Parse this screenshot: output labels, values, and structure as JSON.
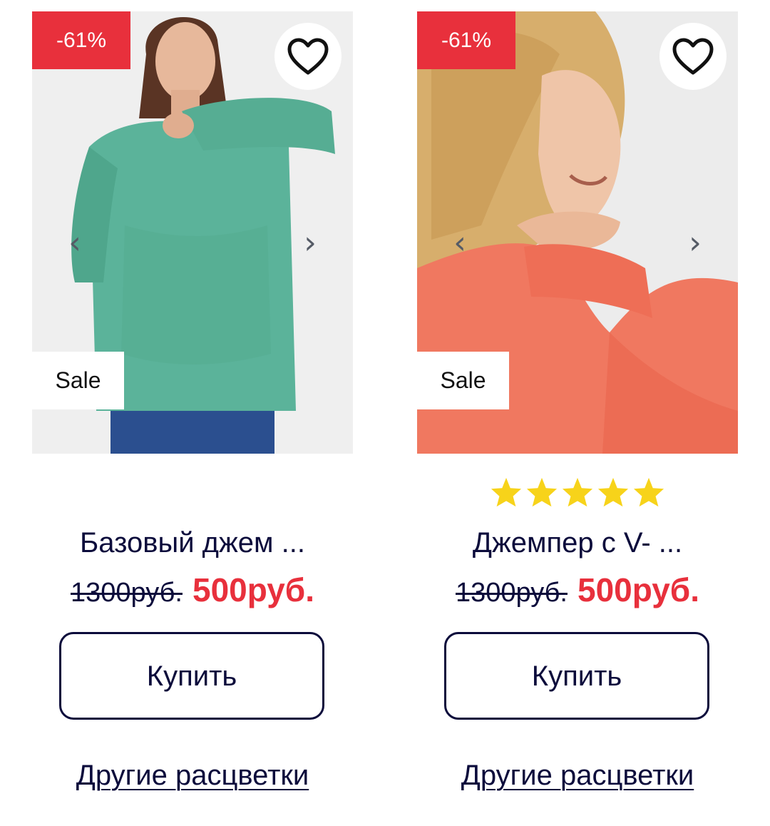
{
  "products": [
    {
      "discount_badge": "-61%",
      "sale_tag": "Sale",
      "prev_arrow": "‹",
      "next_arrow": "›",
      "rating_stars": 0,
      "title": "Базовый джем ...",
      "old_price": "1300руб.",
      "new_price": "500руб.",
      "buy_label": "Купить",
      "colors_link": "Другие расцветки",
      "sweater_color": "#5bb39a",
      "icons": [
        "heart-icon",
        "chevron-left-icon",
        "chevron-right-icon"
      ]
    },
    {
      "discount_badge": "-61%",
      "sale_tag": "Sale",
      "prev_arrow": "‹",
      "next_arrow": "›",
      "rating_stars": 5,
      "title": "Джемпер с V- ...",
      "old_price": "1300руб.",
      "new_price": "500руб.",
      "buy_label": "Купить",
      "colors_link": "Другие расцветки",
      "sweater_color": "#f07860",
      "icons": [
        "heart-icon",
        "chevron-left-icon",
        "chevron-right-icon",
        "star-icon"
      ]
    }
  ],
  "colors": {
    "accent_red": "#e8303c",
    "text_navy": "#0b0b3b",
    "star_yellow": "#f7d31a"
  }
}
